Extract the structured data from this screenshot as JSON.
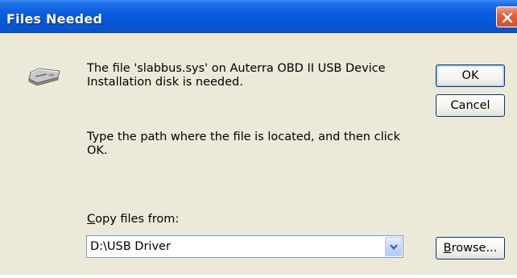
{
  "window": {
    "title": "Files Needed",
    "close_label": "×"
  },
  "icon": {
    "name": "disk-drive-icon"
  },
  "message": {
    "line1": "The file 'slabbus.sys' on Auterra OBD II USB Device Installation disk is needed.",
    "line2": "Type the path where the file is located, and then click OK."
  },
  "copy_from": {
    "label_prefix": "C",
    "label_rest": "opy files from:",
    "value": "D:\\USB Driver"
  },
  "buttons": {
    "ok": "OK",
    "cancel": "Cancel",
    "browse_prefix": "B",
    "browse_rest": "rowse..."
  },
  "colors": {
    "titlebar": "#0a5ee0",
    "dialog_bg": "#ece9d8",
    "close_button": "#e06040",
    "button_border": "#003c74"
  }
}
